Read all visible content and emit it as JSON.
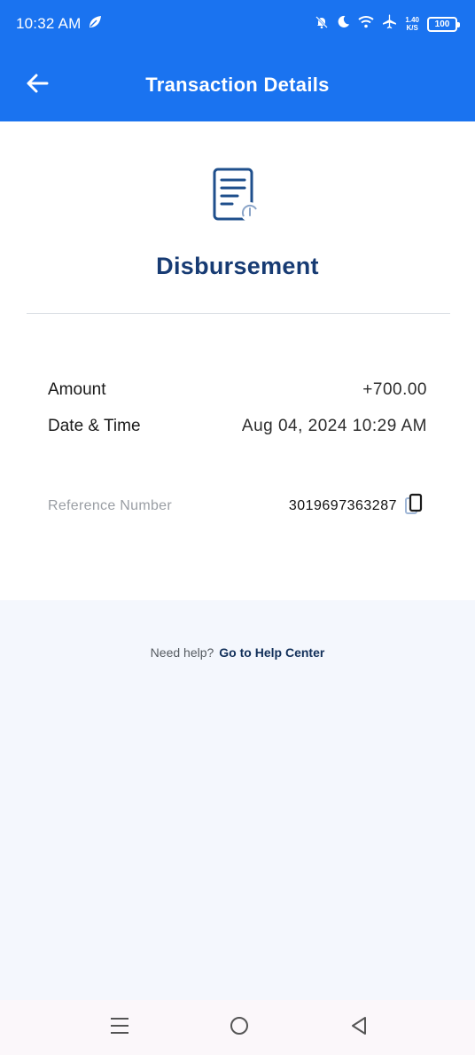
{
  "status_bar": {
    "time": "10:32 AM",
    "network_speed_value": "1.40",
    "network_speed_unit": "K/S",
    "battery": "100",
    "icons": [
      "leaf-icon",
      "mute-bell-icon",
      "moon-icon",
      "wifi-icon",
      "airplane-icon"
    ]
  },
  "header": {
    "title": "Transaction Details",
    "back_icon": "arrow-left-icon"
  },
  "transaction": {
    "type": "Disbursement",
    "amount_label": "Amount",
    "amount_value": "+700.00",
    "datetime_label": "Date & Time",
    "datetime_value": "Aug 04, 2024 10:29 AM",
    "reference_label": "Reference Number",
    "reference_value": "3019697363287"
  },
  "help": {
    "text": "Need help?",
    "link": "Go to Help Center"
  },
  "colors": {
    "brand_blue": "#1a73f0",
    "title_navy": "#173b73",
    "background": "#f4f7fd"
  }
}
